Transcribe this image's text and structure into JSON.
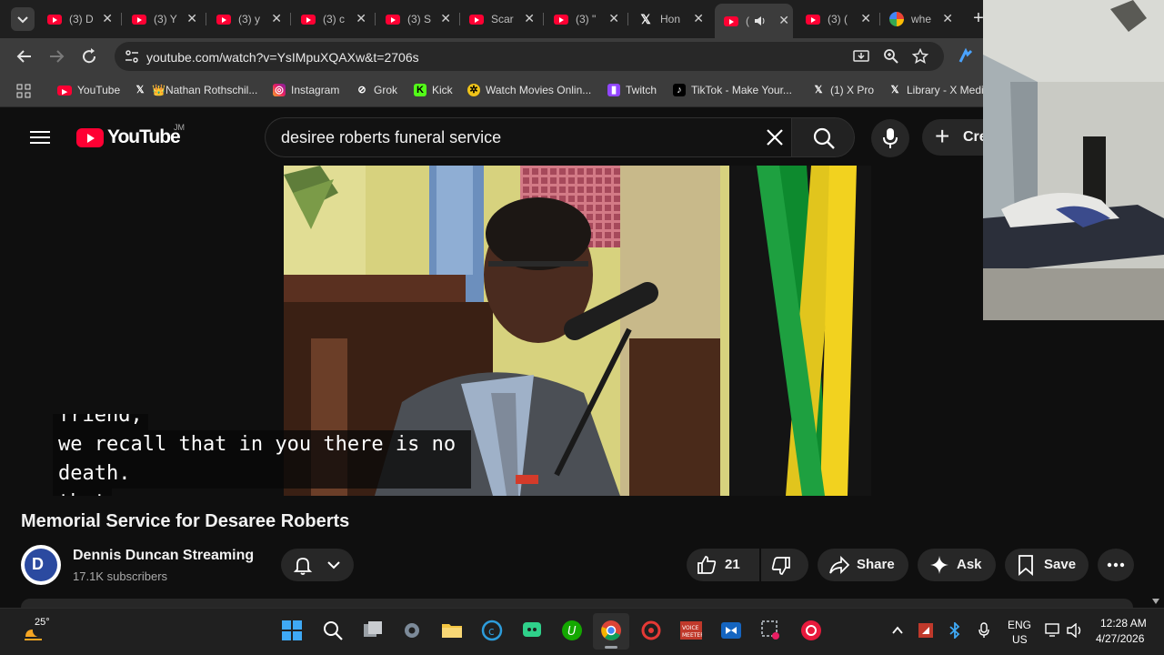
{
  "browser": {
    "tabs": [
      {
        "label": "(3) D",
        "icon": "youtube"
      },
      {
        "label": "(3) Y",
        "icon": "youtube"
      },
      {
        "label": "(3) y",
        "icon": "youtube"
      },
      {
        "label": "(3) c",
        "icon": "youtube"
      },
      {
        "label": "(3) S",
        "icon": "youtube"
      },
      {
        "label": "Scar",
        "icon": "youtube"
      },
      {
        "label": "(3) \"",
        "icon": "youtube"
      },
      {
        "label": "Hon",
        "icon": "x"
      },
      {
        "label": "(",
        "icon": "youtube",
        "active": true
      },
      {
        "label": "(3) (",
        "icon": "youtube"
      },
      {
        "label": "whe",
        "icon": "google"
      }
    ],
    "url": "youtube.com/watch?v=YsIMpuXQAXw&t=2706s",
    "bookmarks": [
      {
        "label": "YouTube"
      },
      {
        "label": "👑Nathan Rothschil..."
      },
      {
        "label": "Instagram"
      },
      {
        "label": "Grok"
      },
      {
        "label": "Kick"
      },
      {
        "label": "Watch Movies Onlin..."
      },
      {
        "label": "Twitch"
      },
      {
        "label": "TikTok - Make Your..."
      },
      {
        "label": "(1) X Pro"
      },
      {
        "label": "Library - X Medi"
      }
    ]
  },
  "youtube": {
    "logo_text": "YouTube",
    "country_code": "JM",
    "search_query": "desiree roberts funeral service",
    "create_label": "Cre",
    "captions": [
      "friend,",
      "we recall that in you there is no death.",
      "that"
    ],
    "video_title": "Memorial Service for Desaree Roberts",
    "channel_initial": "D",
    "channel_name": "Dennis Duncan Streaming",
    "subscribers": "17.1K subscribers",
    "like_count": "21",
    "share_label": "Share",
    "ask_label": "Ask",
    "save_label": "Save"
  },
  "taskbar": {
    "weather_temp": "25°",
    "lang_line1": "ENG",
    "lang_line2": "US",
    "time": "12:28 AM",
    "date": "4/27/2026"
  }
}
